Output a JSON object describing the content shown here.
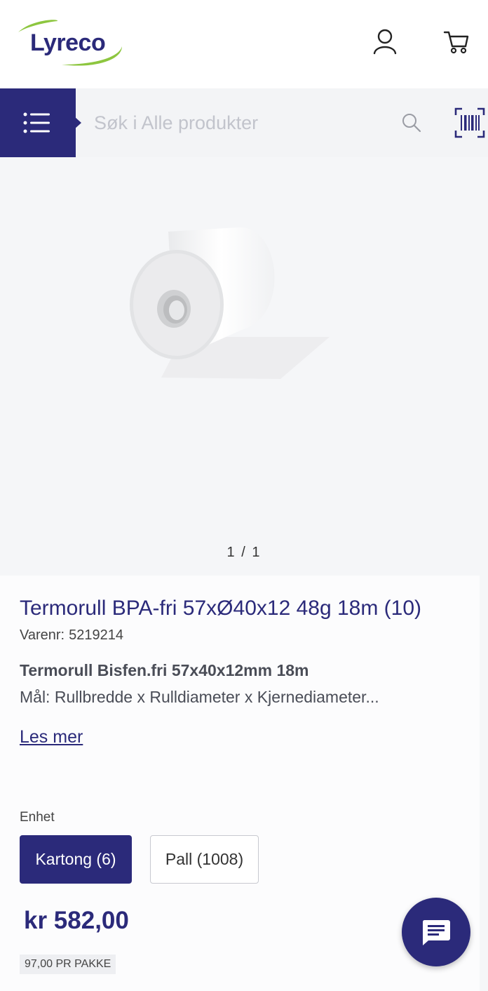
{
  "header": {
    "logo_text": "Lyreco",
    "icons": [
      "user-icon",
      "cart-icon"
    ]
  },
  "search": {
    "placeholder": "Søk i Alle produkter",
    "icons": [
      "menu-icon",
      "search-icon",
      "barcode-scan-icon"
    ]
  },
  "gallery": {
    "pager": "1 / 1",
    "image": "thermal-paper-roll"
  },
  "product": {
    "title": "Termorull BPA-fri 57xØ40x12 48g 18m (10)",
    "sku_label": "Varenr:",
    "sku_value": "5219214",
    "subtitle": "Termorull Bisfen.fri 57x40x12mm 18m",
    "description": "Mål: Rullbredde x Rulldiameter x Kjernediameter...",
    "read_more": "Les mer"
  },
  "units": {
    "label": "Enhet",
    "options": [
      "Kartong (6)",
      "Pall (1008)"
    ],
    "selected": "Kartong (6)"
  },
  "pricing": {
    "price": "kr 582,00",
    "unit_price": "97,00 PR PAKKE"
  },
  "chat": {
    "icon": "chat-icon"
  },
  "colors": {
    "brand": "#2b2a7a",
    "logo_swoosh": "#8dc63f"
  }
}
